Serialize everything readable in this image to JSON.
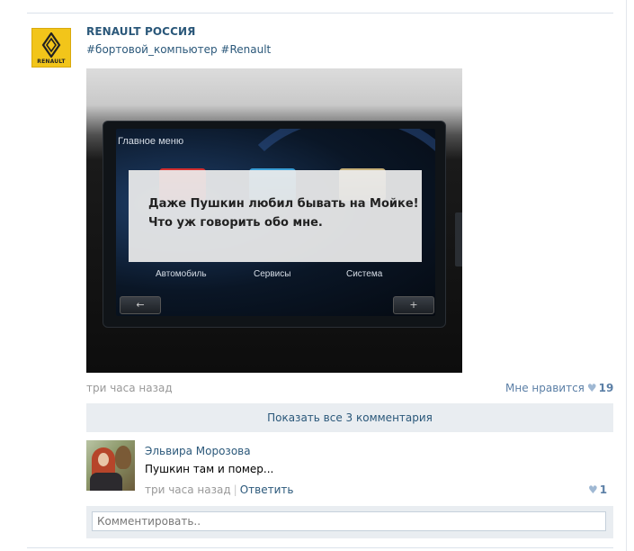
{
  "post": {
    "author": "RENAULT РОССИЯ",
    "logo_text": "RENAULT",
    "tags": "#бортовой_компьютер #Renault",
    "time": "три часа назад",
    "like_label": "Мне нравится",
    "like_count": "19"
  },
  "photo": {
    "menu_title": "Главное меню",
    "overlay_line1": "Даже Пушкин любил бывать на Мойке!",
    "overlay_line2": "Что уж говорить обо мне.",
    "apps": [
      {
        "label": "Автомобиль",
        "color": "#d8302f"
      },
      {
        "label": "Сервисы",
        "color": "#3aa0d8"
      },
      {
        "label": "Система",
        "color": "#c9b27a"
      }
    ],
    "back_glyph": "←",
    "plus_glyph": "+"
  },
  "comments": {
    "show_all": "Показать все 3 комментария",
    "items": [
      {
        "author": "Эльвира Морозова",
        "text": "Пушкин там и помер...",
        "time": "три часа назад",
        "separator": "|",
        "reply": "Ответить",
        "like_count": "1"
      }
    ],
    "input_placeholder": "Комментировать.."
  },
  "colors": {
    "link": "#2b587a",
    "muted": "#999999",
    "panel": "#e9edf1",
    "heart": "#9fb8d3",
    "logo_yellow": "#f2c51a"
  }
}
